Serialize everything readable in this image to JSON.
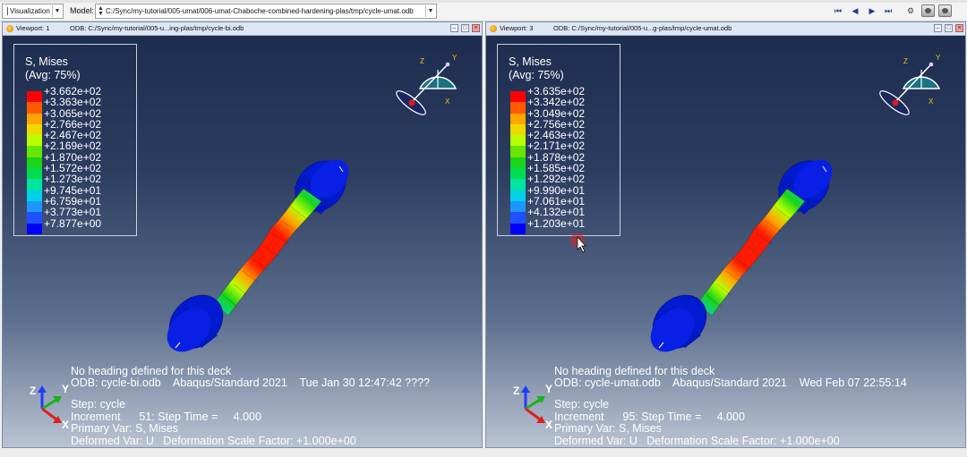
{
  "toolbar": {
    "module": "Visualization",
    "model_label": "Model:",
    "model_path": "C:/Sync/my-tutorial/005-umat/006-umat-Chaboche-combined-hardening-plas/tmp/cycle-umat.odb",
    "playback": [
      "⏮",
      "◀",
      "▶",
      "⏭"
    ],
    "icons": [
      "animate-icon",
      "capture-icon",
      "camera-icon"
    ]
  },
  "viewports": [
    {
      "name": "Viewport: 1",
      "odb": "ODB: C:/Sync/my-tutorial/005-u...ing-plas/tmp/cycle-bi.odb",
      "legend_title": "S, Mises",
      "legend_avg": "(Avg: 75%)",
      "legend_values": [
        "+3.662e+02",
        "+3.363e+02",
        "+3.065e+02",
        "+2.766e+02",
        "+2.467e+02",
        "+2.169e+02",
        "+1.870e+02",
        "+1.572e+02",
        "+1.273e+02",
        "+9.745e+01",
        "+6.759e+01",
        "+3.773e+01",
        "+7.877e+00"
      ],
      "heading": "No heading defined for this deck",
      "odb_line": "ODB: cycle-bi.odb    Abaqus/Standard 2021    Tue Jan 30 12:47:42 ????",
      "step": "Step: cycle",
      "increment": "Increment      51: Step Time =     4.000",
      "primary": "Primary Var: S, Mises",
      "deformed": "Deformed Var: U   Deformation Scale Factor: +1.000e+00",
      "triad_labels": [
        "Y",
        "Z",
        "X"
      ]
    },
    {
      "name": "Viewport: 3",
      "odb": "ODB: C:/Sync/my-tutorial/005-u...g-plas/tmp/cycle-umat.odb",
      "legend_title": "S, Mises",
      "legend_avg": "(Avg: 75%)",
      "legend_values": [
        "+3.635e+02",
        "+3.342e+02",
        "+3.049e+02",
        "+2.756e+02",
        "+2.463e+02",
        "+2.171e+02",
        "+1.878e+02",
        "+1.585e+02",
        "+1.292e+02",
        "+9.990e+01",
        "+7.061e+01",
        "+4.132e+01",
        "+1.203e+01"
      ],
      "heading": "No heading defined for this deck",
      "odb_line": "ODB: cycle-umat.odb    Abaqus/Standard 2021    Wed Feb 07 22:55:14",
      "step": "Step: cycle",
      "increment": "Increment      95: Step Time =     4.000",
      "primary": "Primary Var: S, Mises",
      "deformed": "Deformed Var: U   Deformation Scale Factor: +1.000e+00",
      "triad_labels": [
        "Y",
        "Z",
        "X"
      ]
    }
  ],
  "contour_colors": [
    "#ff0000",
    "#ff5a00",
    "#ffa500",
    "#f0d800",
    "#b8ff00",
    "#66e600",
    "#19d419",
    "#00dc50",
    "#00e6a0",
    "#00d2e6",
    "#1e96ff",
    "#1e50ff",
    "#0000ff"
  ]
}
